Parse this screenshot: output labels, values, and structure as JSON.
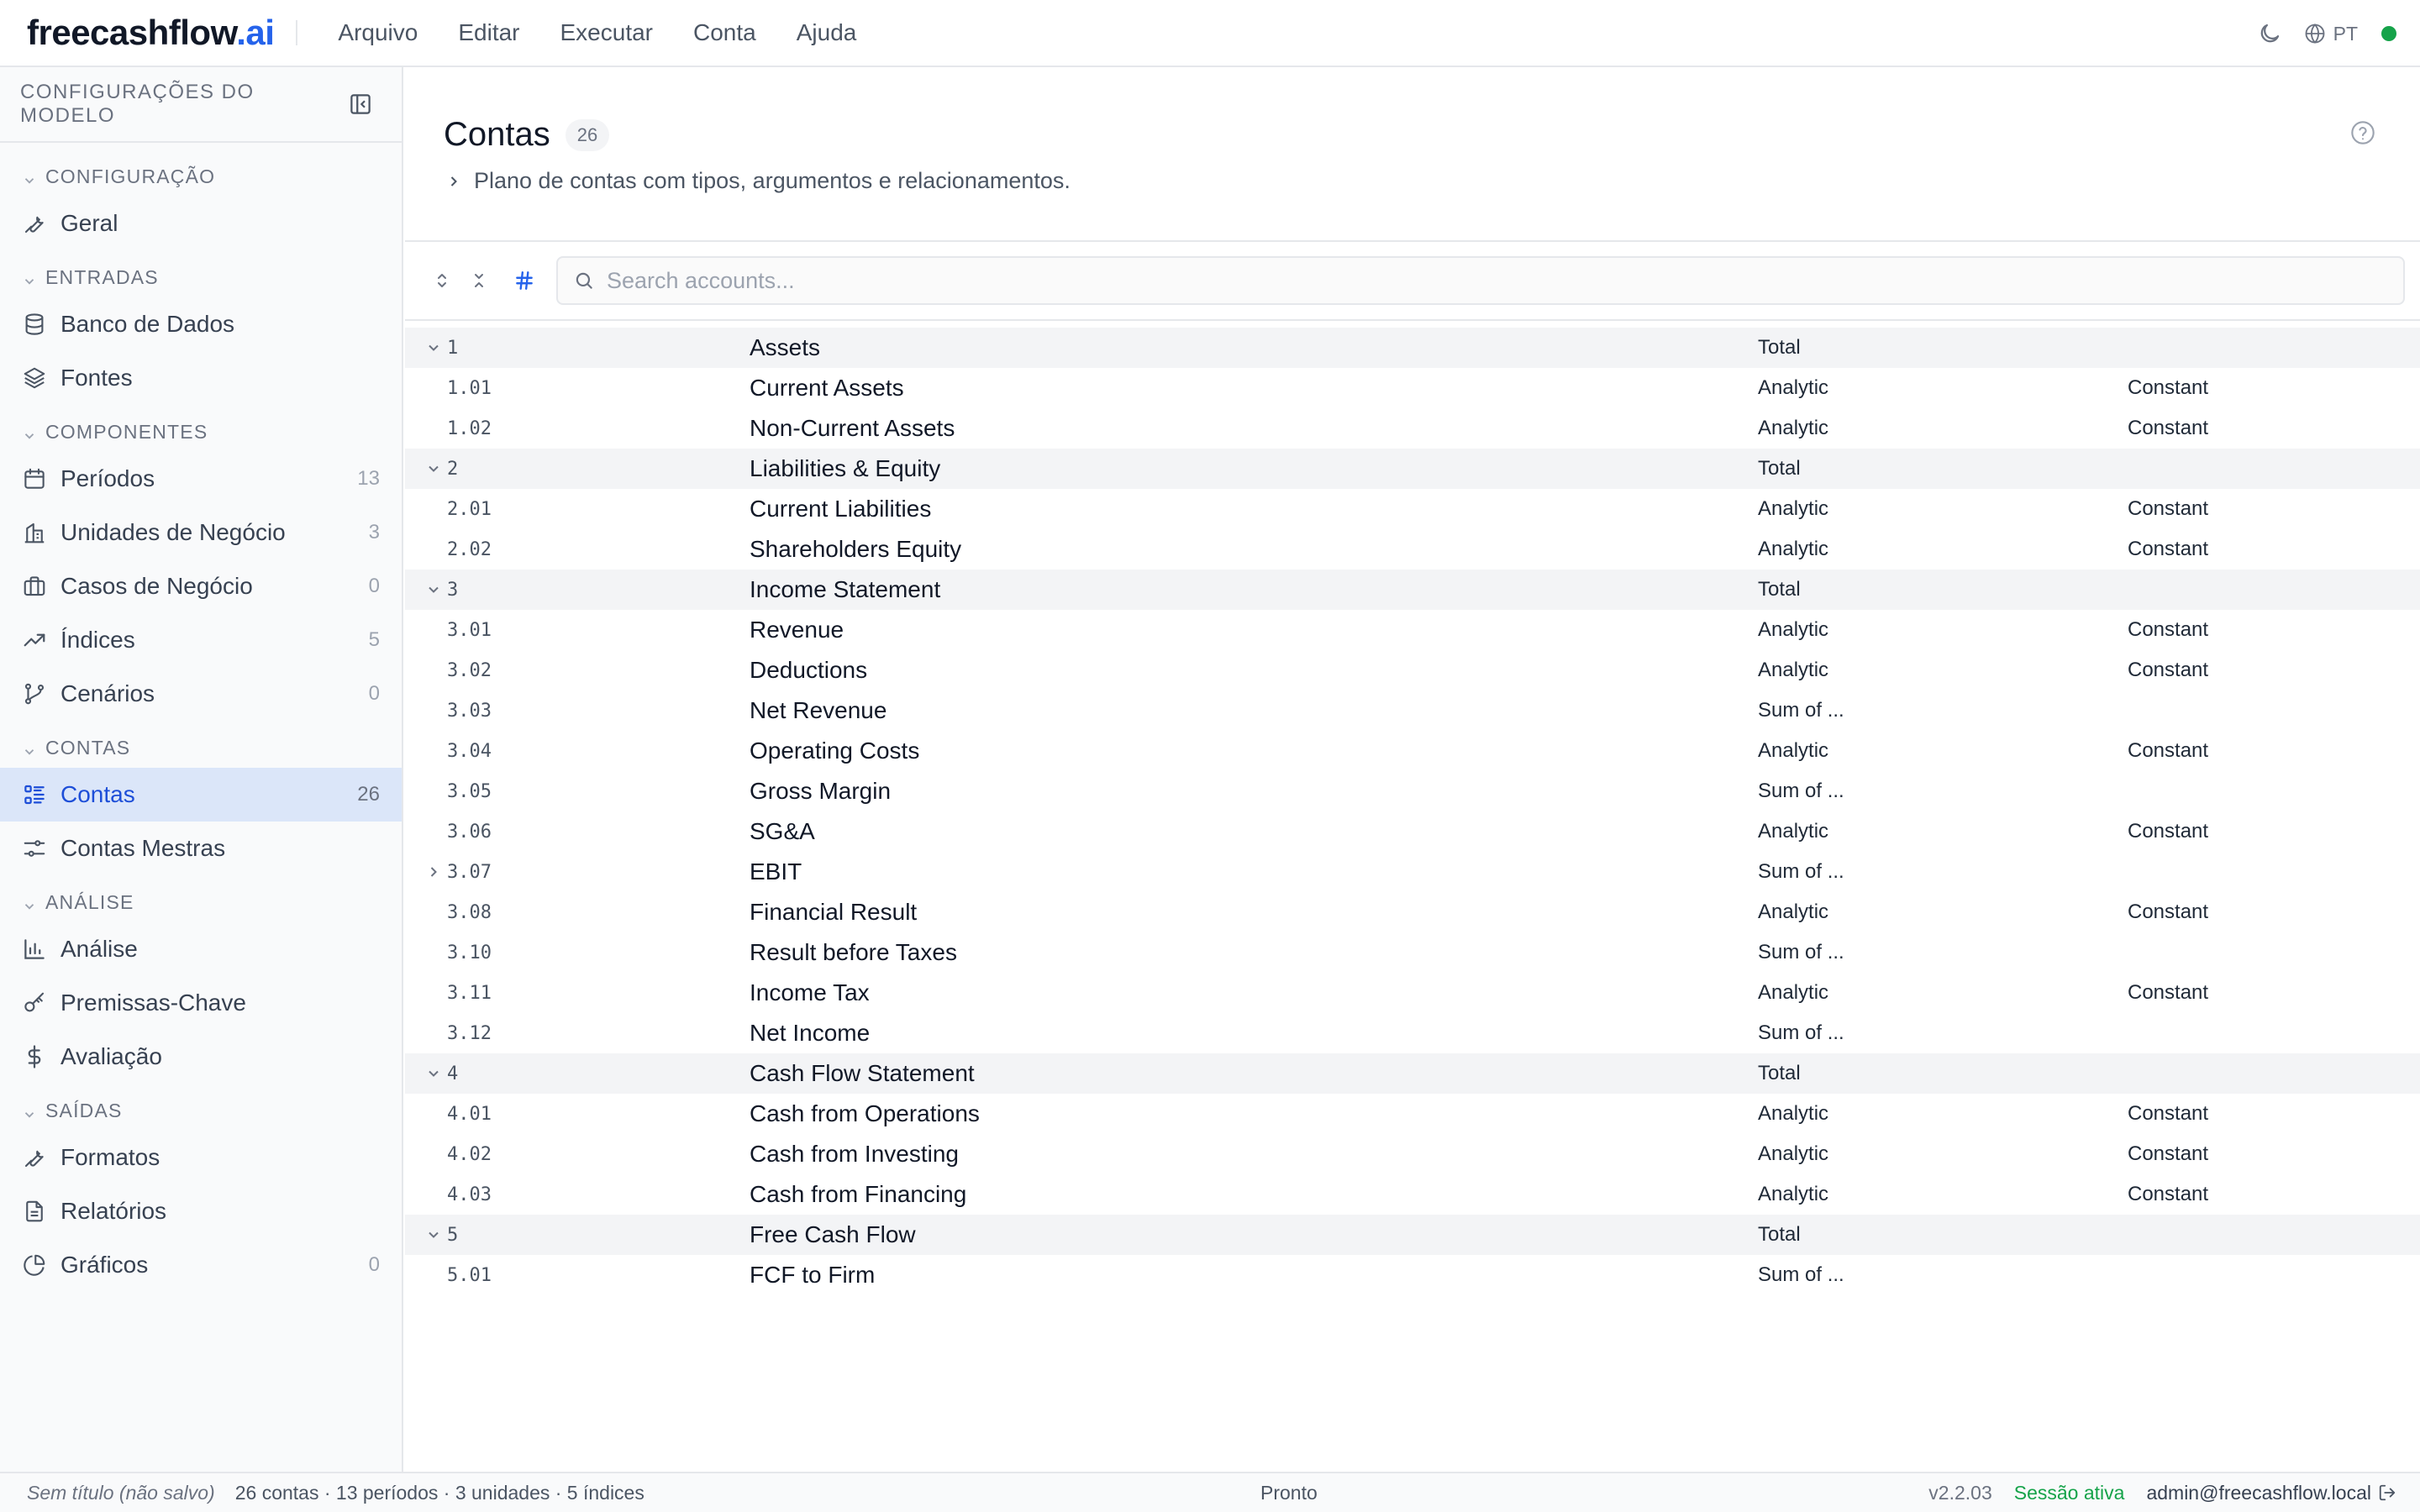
{
  "app": {
    "logo_main": "freecashflow",
    "logo_accent": ".ai",
    "colors": {
      "accent": "#2563eb",
      "active_bg": "#dbe6f9",
      "status_ok": "#16a34a",
      "group_row_bg": "#f3f4f6"
    }
  },
  "menu": [
    {
      "label": "Arquivo"
    },
    {
      "label": "Editar"
    },
    {
      "label": "Executar"
    },
    {
      "label": "Conta"
    },
    {
      "label": "Ajuda"
    }
  ],
  "topbar": {
    "theme_icon": "moon-icon",
    "language": "PT",
    "language_icon": "globe-icon",
    "status": "online"
  },
  "sidebar": {
    "title": "CONFIGURAÇÕES DO MODELO",
    "sections": [
      {
        "title": "CONFIGURAÇÃO",
        "items": [
          {
            "label": "Geral",
            "icon": "wrench-icon",
            "count": ""
          }
        ]
      },
      {
        "title": "ENTRADAS",
        "items": [
          {
            "label": "Banco de Dados",
            "icon": "database-icon",
            "count": ""
          },
          {
            "label": "Fontes",
            "icon": "layers-icon",
            "count": ""
          }
        ]
      },
      {
        "title": "COMPONENTES",
        "items": [
          {
            "label": "Períodos",
            "icon": "calendar-icon",
            "count": "13"
          },
          {
            "label": "Unidades de Negócio",
            "icon": "building-icon",
            "count": "3"
          },
          {
            "label": "Casos de Negócio",
            "icon": "briefcase-icon",
            "count": "0"
          },
          {
            "label": "Índices",
            "icon": "trending-up-icon",
            "count": "5"
          },
          {
            "label": "Cenários",
            "icon": "git-branch-icon",
            "count": "0"
          }
        ]
      },
      {
        "title": "CONTAS",
        "items": [
          {
            "label": "Contas",
            "icon": "list-tree-icon",
            "count": "26",
            "active": true
          },
          {
            "label": "Contas Mestras",
            "icon": "sliders-icon",
            "count": ""
          }
        ]
      },
      {
        "title": "ANÁLISE",
        "items": [
          {
            "label": "Análise",
            "icon": "bar-chart-icon",
            "count": ""
          },
          {
            "label": "Premissas-Chave",
            "icon": "key-icon",
            "count": ""
          },
          {
            "label": "Avaliação",
            "icon": "dollar-icon",
            "count": ""
          }
        ]
      },
      {
        "title": "SAÍDAS",
        "items": [
          {
            "label": "Formatos",
            "icon": "wrench-icon",
            "count": ""
          },
          {
            "label": "Relatórios",
            "icon": "file-text-icon",
            "count": ""
          },
          {
            "label": "Gráficos",
            "icon": "pie-chart-icon",
            "count": "0"
          }
        ]
      }
    ]
  },
  "page": {
    "title": "Contas",
    "count": "26",
    "subtitle": "Plano de contas com tipos, argumentos e relacionamentos."
  },
  "search": {
    "placeholder": "Search accounts...",
    "value": ""
  },
  "accounts": [
    {
      "code": "1",
      "name": "Assets",
      "type": "Total",
      "arg": "",
      "group": true,
      "caret": "down"
    },
    {
      "code": "1.01",
      "name": "Current Assets",
      "type": "Analytic",
      "arg": "Constant",
      "group": false,
      "caret": ""
    },
    {
      "code": "1.02",
      "name": "Non-Current Assets",
      "type": "Analytic",
      "arg": "Constant",
      "group": false,
      "caret": ""
    },
    {
      "code": "2",
      "name": "Liabilities & Equity",
      "type": "Total",
      "arg": "",
      "group": true,
      "caret": "down"
    },
    {
      "code": "2.01",
      "name": "Current Liabilities",
      "type": "Analytic",
      "arg": "Constant",
      "group": false,
      "caret": ""
    },
    {
      "code": "2.02",
      "name": "Shareholders Equity",
      "type": "Analytic",
      "arg": "Constant",
      "group": false,
      "caret": ""
    },
    {
      "code": "3",
      "name": "Income Statement",
      "type": "Total",
      "arg": "",
      "group": true,
      "caret": "down"
    },
    {
      "code": "3.01",
      "name": "Revenue",
      "type": "Analytic",
      "arg": "Constant",
      "group": false,
      "caret": ""
    },
    {
      "code": "3.02",
      "name": "Deductions",
      "type": "Analytic",
      "arg": "Constant",
      "group": false,
      "caret": ""
    },
    {
      "code": "3.03",
      "name": "Net Revenue",
      "type": "Sum of ...",
      "arg": "",
      "group": false,
      "caret": ""
    },
    {
      "code": "3.04",
      "name": "Operating Costs",
      "type": "Analytic",
      "arg": "Constant",
      "group": false,
      "caret": ""
    },
    {
      "code": "3.05",
      "name": "Gross Margin",
      "type": "Sum of ...",
      "arg": "",
      "group": false,
      "caret": ""
    },
    {
      "code": "3.06",
      "name": "SG&A",
      "type": "Analytic",
      "arg": "Constant",
      "group": false,
      "caret": ""
    },
    {
      "code": "3.07",
      "name": "EBIT",
      "type": "Sum of ...",
      "arg": "",
      "group": false,
      "caret": "right"
    },
    {
      "code": "3.08",
      "name": "Financial Result",
      "type": "Analytic",
      "arg": "Constant",
      "group": false,
      "caret": ""
    },
    {
      "code": "3.10",
      "name": "Result before Taxes",
      "type": "Sum of ...",
      "arg": "",
      "group": false,
      "caret": ""
    },
    {
      "code": "3.11",
      "name": "Income Tax",
      "type": "Analytic",
      "arg": "Constant",
      "group": false,
      "caret": ""
    },
    {
      "code": "3.12",
      "name": "Net Income",
      "type": "Sum of ...",
      "arg": "",
      "group": false,
      "caret": ""
    },
    {
      "code": "4",
      "name": "Cash Flow Statement",
      "type": "Total",
      "arg": "",
      "group": true,
      "caret": "down"
    },
    {
      "code": "4.01",
      "name": "Cash from Operations",
      "type": "Analytic",
      "arg": "Constant",
      "group": false,
      "caret": ""
    },
    {
      "code": "4.02",
      "name": "Cash from Investing",
      "type": "Analytic",
      "arg": "Constant",
      "group": false,
      "caret": ""
    },
    {
      "code": "4.03",
      "name": "Cash from Financing",
      "type": "Analytic",
      "arg": "Constant",
      "group": false,
      "caret": ""
    },
    {
      "code": "5",
      "name": "Free Cash Flow",
      "type": "Total",
      "arg": "",
      "group": true,
      "caret": "down"
    },
    {
      "code": "5.01",
      "name": "FCF to Firm",
      "type": "Sum of ...",
      "arg": "",
      "group": false,
      "caret": ""
    }
  ],
  "statusbar": {
    "file": "Sem título (não salvo)",
    "summary": "26 contas · 13 períodos · 3 unidades · 5 índices",
    "state": "Pronto",
    "version": "v2.2.03",
    "session": "Sessão ativa",
    "user": "admin@freecashflow.local"
  }
}
